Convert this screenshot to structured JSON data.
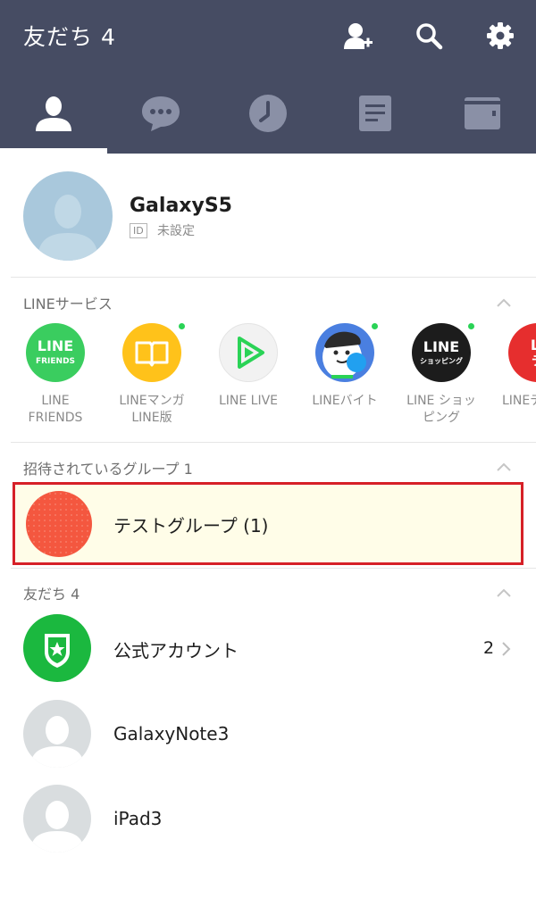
{
  "header": {
    "title": "友だち 4",
    "icons": [
      "add-friend-icon",
      "search-icon",
      "settings-gear-icon"
    ],
    "tabs": [
      "friends-tab",
      "chats-tab",
      "timeline-tab",
      "news-tab",
      "wallet-tab"
    ],
    "active_tab": "friends-tab"
  },
  "profile": {
    "name": "GalaxyS5",
    "id_badge": "ID",
    "id_status": "未設定"
  },
  "services": {
    "title": "LINEサービス",
    "items": [
      {
        "label": "LINE\nFRIENDS",
        "icon": "line-friends-icon",
        "icon_text_1": "LINE",
        "icon_text_2": "FRIENDS",
        "new_dot": false
      },
      {
        "label": "LINEマンガ\nLINE版",
        "icon": "line-manga-icon",
        "new_dot": true
      },
      {
        "label": "LINE LIVE",
        "icon": "line-live-icon",
        "new_dot": false
      },
      {
        "label": "LINEバイト",
        "icon": "line-baito-icon",
        "new_dot": true
      },
      {
        "label": "LINE ショッ\nピング",
        "icon": "line-shopping-icon",
        "icon_text_1": "LINE",
        "icon_text_2": "ショッピング",
        "new_dot": true
      },
      {
        "label": "LINEデ",
        "icon": "line-de-icon",
        "icon_text_1": "LI",
        "icon_text_2": "デ",
        "new_dot": false
      }
    ]
  },
  "invited_groups": {
    "title": "招待されているグループ 1",
    "items": [
      {
        "name": "テストグループ (1)"
      }
    ]
  },
  "friends": {
    "title": "友だち 4",
    "official_account": {
      "label": "公式アカウント",
      "count": "2"
    },
    "items": [
      {
        "name": "GalaxyNote3"
      },
      {
        "name": "iPad3"
      }
    ]
  },
  "colors": {
    "header_bg": "#464c63",
    "highlight_border": "#d62027",
    "highlight_bg": "#fffde8",
    "new_dot": "#2ad356",
    "official_green": "#1bb83f"
  }
}
